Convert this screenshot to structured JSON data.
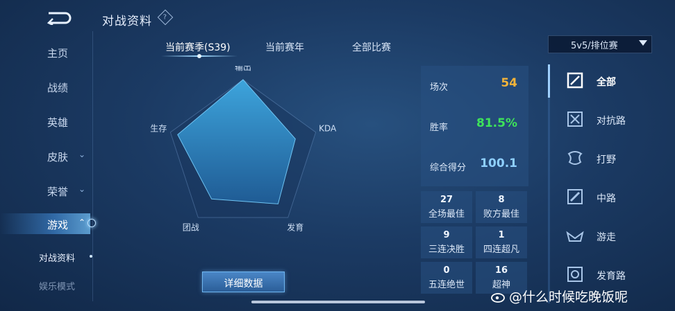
{
  "header": {
    "title": "对战资料",
    "help_icon": "?"
  },
  "nav": {
    "items": [
      {
        "label": "主页"
      },
      {
        "label": "战绩"
      },
      {
        "label": "英雄"
      },
      {
        "label": "皮肤",
        "chevron": "⌄"
      },
      {
        "label": "荣誉",
        "chevron": "⌄"
      },
      {
        "label": "游戏",
        "chevron": "⌃"
      }
    ],
    "sub_items": [
      {
        "label": "对战资料"
      },
      {
        "label": "娱乐模式"
      }
    ]
  },
  "tabs": [
    {
      "label": "当前赛季(S39)"
    },
    {
      "label": "当前赛年"
    },
    {
      "label": "全部比赛"
    }
  ],
  "mode_select": {
    "value": "5v5/排位赛"
  },
  "radar": {
    "axes": [
      "输出",
      "KDA",
      "发育",
      "团战",
      "生存"
    ],
    "values": [
      1.0,
      0.72,
      0.78,
      0.7,
      0.9
    ]
  },
  "stats": [
    {
      "label": "场次",
      "value": "54",
      "color": "#f2b33a"
    },
    {
      "label": "胜率",
      "value": "81.5%",
      "color": "#3ee35a"
    },
    {
      "label": "综合得分",
      "value": "100.1",
      "color": "#8fd0ff"
    }
  ],
  "achievements": [
    {
      "count": "27",
      "label": "全场最佳"
    },
    {
      "count": "8",
      "label": "败方最佳"
    },
    {
      "count": "9",
      "label": "三连决胜"
    },
    {
      "count": "1",
      "label": "四连超凡"
    },
    {
      "count": "0",
      "label": "五连绝世"
    },
    {
      "count": "16",
      "label": "超神"
    }
  ],
  "detail_button": "详细数据",
  "positions": [
    {
      "label": "全部",
      "icon": "all-positions-icon"
    },
    {
      "label": "对抗路",
      "icon": "clash-lane-icon"
    },
    {
      "label": "打野",
      "icon": "jungle-icon"
    },
    {
      "label": "中路",
      "icon": "mid-lane-icon"
    },
    {
      "label": "游走",
      "icon": "roam-icon"
    },
    {
      "label": "发育路",
      "icon": "farm-lane-icon"
    }
  ],
  "watermark": "@什么时候吃晚饭呢"
}
